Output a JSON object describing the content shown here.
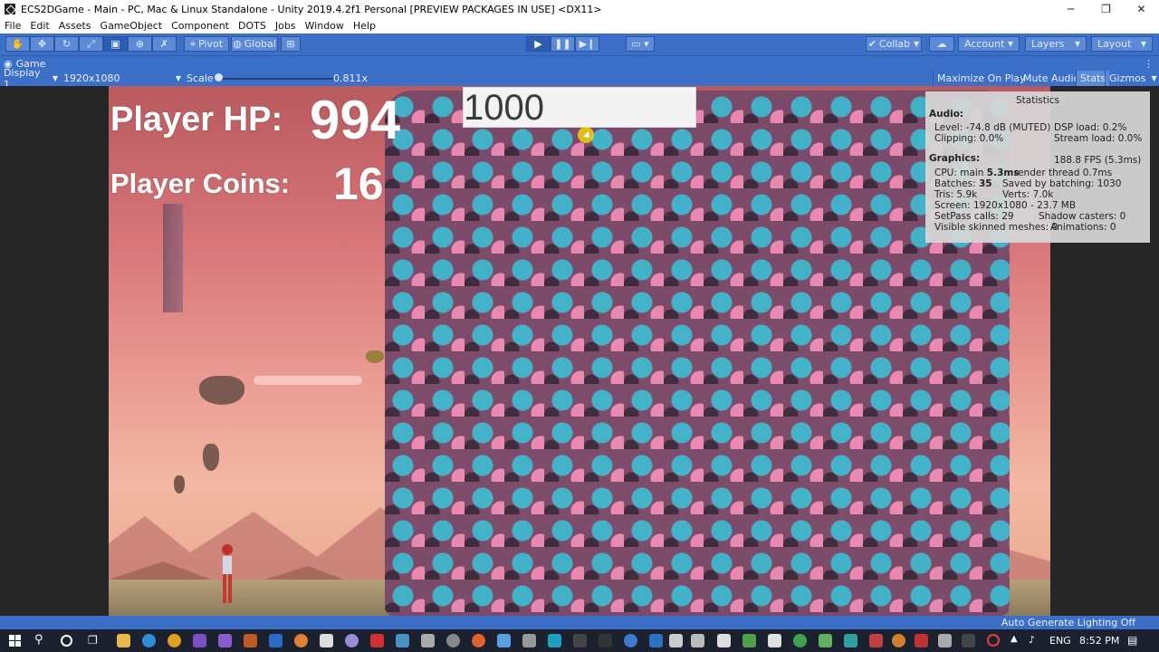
{
  "window": {
    "title": "ECS2DGame - Main - PC, Mac & Linux Standalone - Unity 2019.4.2f1 Personal [PREVIEW PACKAGES IN USE] <DX11>",
    "minimize": "─",
    "restore": "❐",
    "close": "✕"
  },
  "menu": [
    "File",
    "Edit",
    "Assets",
    "GameObject",
    "Component",
    "DOTS",
    "Jobs",
    "Window",
    "Help"
  ],
  "toolbar": {
    "pivot_label": "Pivot",
    "global_label": "Global",
    "collab_label": "Collab",
    "account_label": "Account",
    "layers_label": "Layers",
    "layout_label": "Layout"
  },
  "game_tab": {
    "label": "Game"
  },
  "game_bar": {
    "display": "Display 1",
    "resolution": "1920x1080",
    "scale_label": "Scale",
    "scale_value": "0.811x",
    "maximize_on_play": "Maximize On Play",
    "mute_audio": "Mute Audio",
    "stats": "Stats",
    "gizmos": "Gizmos"
  },
  "hud": {
    "hp_label": "Player HP:",
    "hp_value": "994",
    "coins_label": "Player Coins:",
    "coins_value": "16",
    "counter": "1000"
  },
  "stats_panel": {
    "title": "Statistics",
    "audio_header": "Audio:",
    "level": "Level: -74.8 dB (MUTED)",
    "dsp_load": "DSP load: 0.2%",
    "clipping": "Clipping: 0.0%",
    "stream_load": "Stream load: 0.0%",
    "graphics_header": "Graphics:",
    "fps": "188.8 FPS (5.3ms)",
    "cpu_prefix": "CPU: main ",
    "cpu_main": "5.3ms",
    "render_thread": "render thread 0.7ms",
    "batches_prefix": "Batches: ",
    "batches": "35",
    "saved_batching": "Saved by batching: 1030",
    "tris": "Tris: 5.9k",
    "verts": "Verts: 7.0k",
    "screen": "Screen: 1920x1080 - 23.7 MB",
    "setpass": "SetPass calls: 29",
    "shadow_casters": "Shadow casters: 0",
    "skinned_meshes": "Visible skinned meshes: 0",
    "animations": "Animations: 0"
  },
  "status": {
    "lighting": "Auto Generate Lighting Off"
  },
  "taskbar": {
    "language": "ENG",
    "time": "8:52 PM"
  }
}
